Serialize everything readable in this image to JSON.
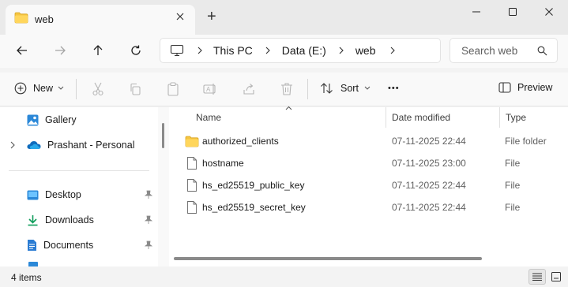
{
  "window": {
    "tab_title": "web",
    "new_tab_symbol": "+"
  },
  "nav": {
    "breadcrumbs": [
      "This PC",
      "Data (E:)",
      "web"
    ],
    "search_placeholder": "Search web"
  },
  "commands": {
    "new_label": "New",
    "sort_label": "Sort",
    "more_label": "•••",
    "preview_label": "Preview"
  },
  "sidebar": {
    "items": [
      {
        "label": "Gallery",
        "icon": "gallery-icon"
      },
      {
        "label": "Prashant - Personal",
        "icon": "onedrive-icon"
      },
      {
        "label": "Desktop",
        "icon": "desktop-icon",
        "pinned": true
      },
      {
        "label": "Downloads",
        "icon": "downloads-icon",
        "pinned": true
      },
      {
        "label": "Documents",
        "icon": "documents-icon",
        "pinned": true
      }
    ]
  },
  "table": {
    "columns": [
      "Name",
      "Date modified",
      "Type"
    ],
    "rows": [
      {
        "name": "authorized_clients",
        "date": "07-11-2025 22:44",
        "type": "File folder",
        "icon": "folder-icon"
      },
      {
        "name": "hostname",
        "date": "07-11-2025 23:00",
        "type": "File",
        "icon": "file-icon"
      },
      {
        "name": "hs_ed25519_public_key",
        "date": "07-11-2025 22:44",
        "type": "File",
        "icon": "file-icon"
      },
      {
        "name": "hs_ed25519_secret_key",
        "date": "07-11-2025 22:44",
        "type": "File",
        "icon": "file-icon"
      }
    ]
  },
  "status": {
    "item_count": "4 items"
  },
  "colors": {
    "folder": "#f5c542",
    "accent": "#0067c0"
  }
}
